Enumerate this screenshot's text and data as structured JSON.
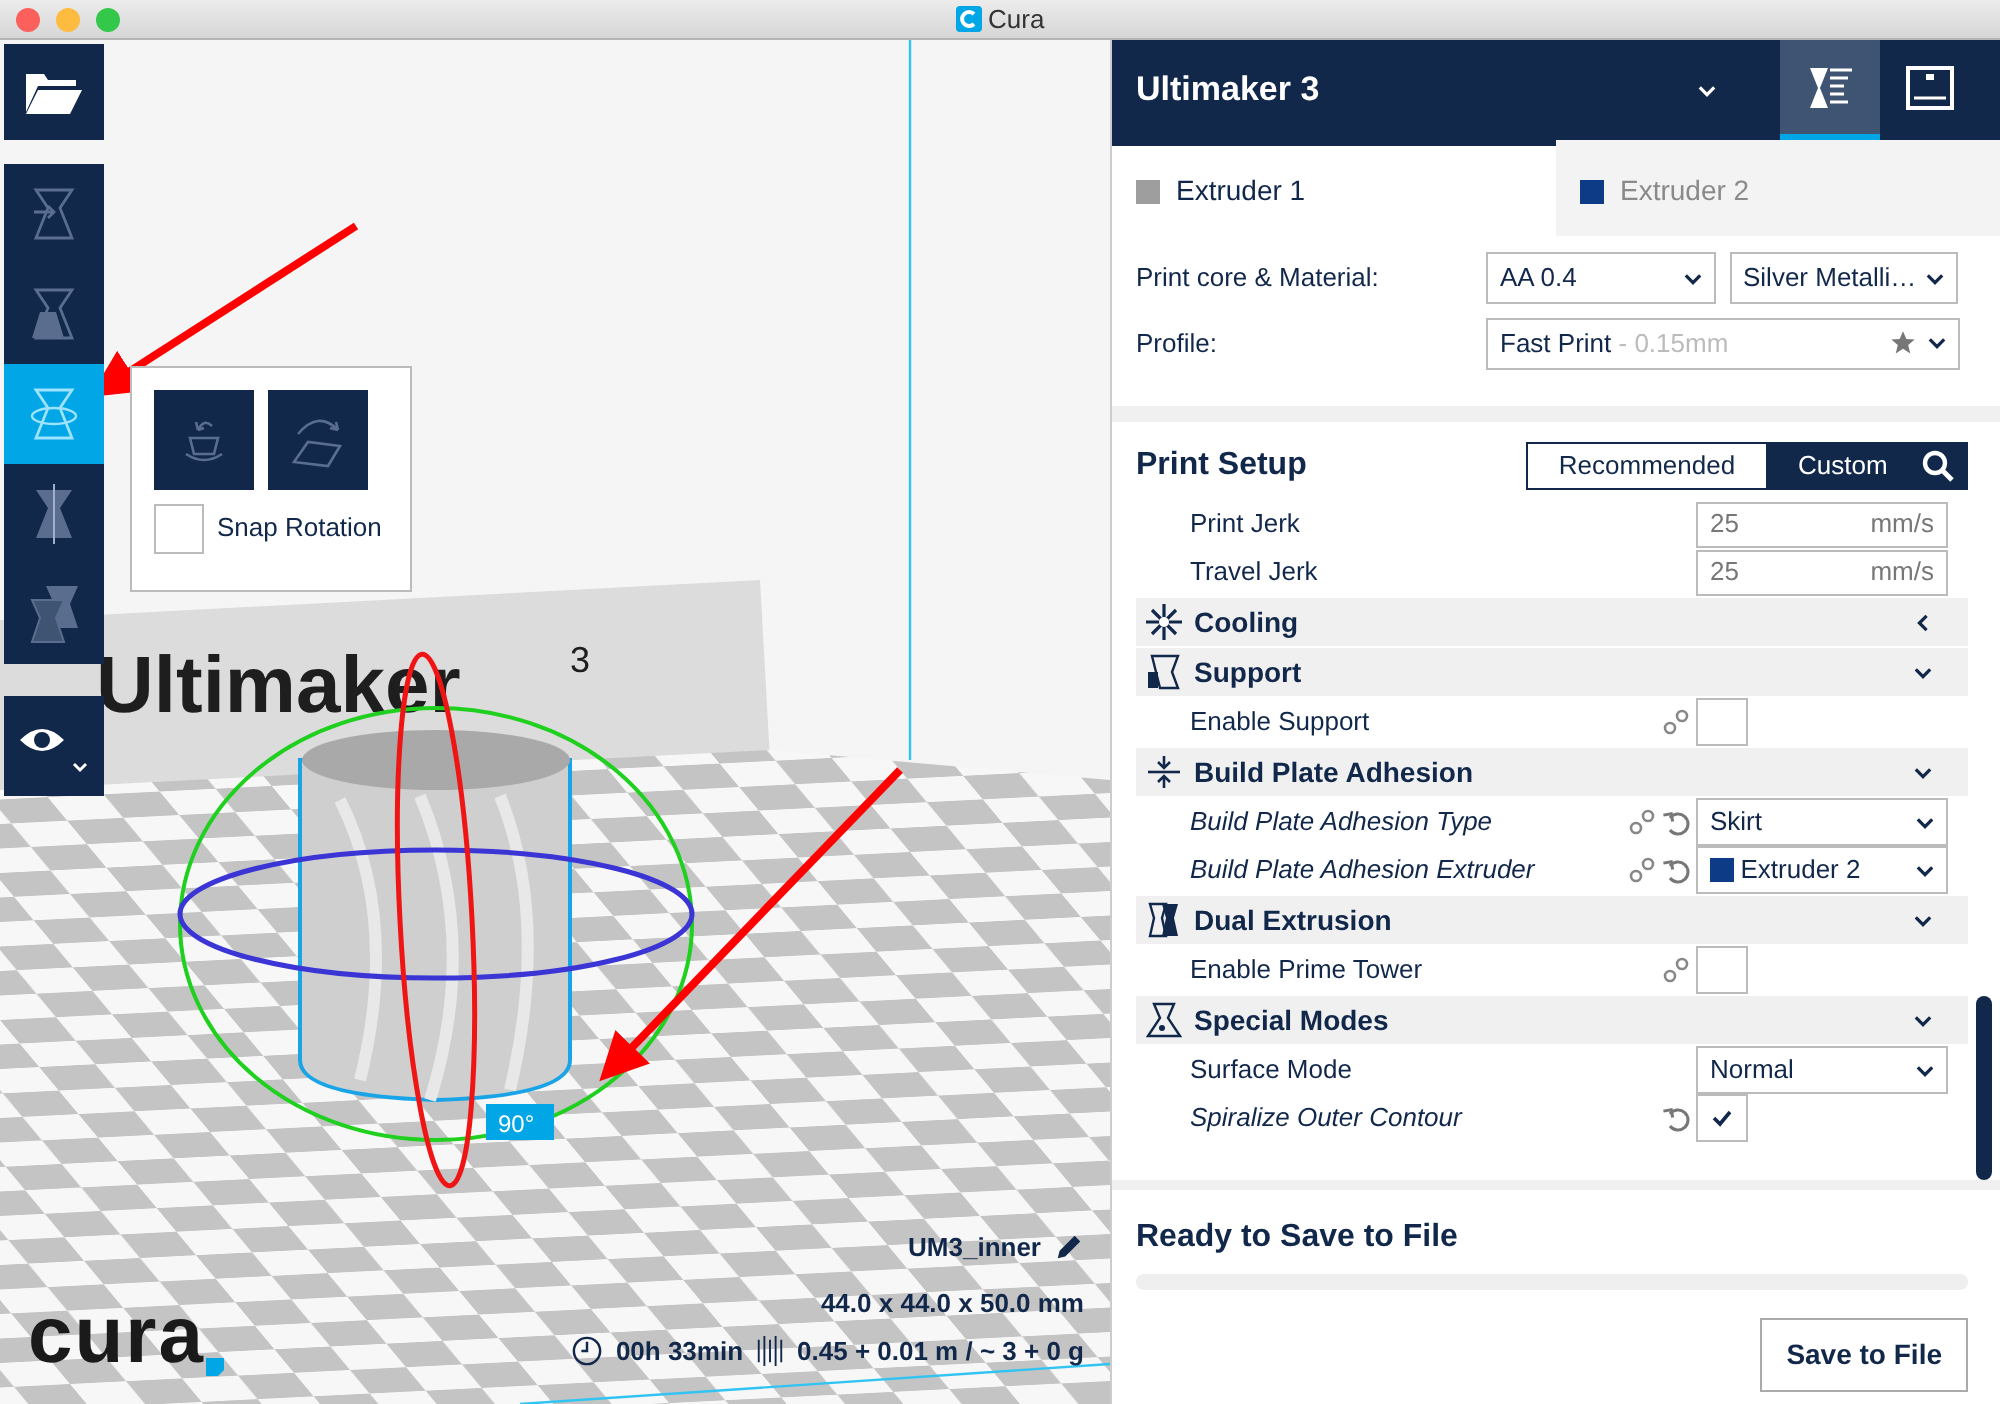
{
  "window": {
    "title": "Cura"
  },
  "tools": [
    {
      "selected": false
    },
    {
      "selected": false
    },
    {
      "selected": true
    },
    {
      "selected": false
    },
    {
      "selected": false
    }
  ],
  "rotate_panel": {
    "snap_label": "Snap Rotation",
    "snap_checked": false
  },
  "viewport": {
    "wall_logo": "Ultimaker",
    "wall_logo_superscript": "3",
    "angle_label": "90°",
    "brand": "cura",
    "job_name": "UM3_inner",
    "dimensions": "44.0 x 44.0 x 50.0 mm",
    "print_time": "00h 33min",
    "material_usage": "0.45 + 0.01 m / ~ 3 + 0 g"
  },
  "printer": {
    "name": "Ultimaker 3"
  },
  "header_tabs": [
    {
      "selected": true
    },
    {
      "selected": false
    }
  ],
  "extruders": [
    {
      "label": "Extruder 1",
      "color": "#9e9e9e",
      "selected": true
    },
    {
      "label": "Extruder 2",
      "color": "#0d3b85",
      "selected": false
    }
  ],
  "print_core": {
    "label": "Print core & Material:",
    "core": "AA 0.4",
    "material": "Silver Metalli…"
  },
  "profile": {
    "label": "Profile:",
    "name": "Fast Print",
    "detail": "- 0.15mm"
  },
  "print_setup": {
    "title": "Print Setup",
    "modes": [
      {
        "label": "Recommended",
        "selected": false
      },
      {
        "label": "Custom",
        "selected": true
      }
    ]
  },
  "settings": [
    {
      "kind": "number",
      "label": "Print Jerk",
      "value": "25",
      "unit": "mm/s"
    },
    {
      "kind": "number",
      "label": "Travel Jerk",
      "value": "25",
      "unit": "mm/s"
    },
    {
      "kind": "category",
      "label": "Cooling",
      "expanded": false
    },
    {
      "kind": "category",
      "label": "Support",
      "expanded": true
    },
    {
      "kind": "checkbox",
      "label": "Enable Support",
      "checked": false,
      "linked": true
    },
    {
      "kind": "category",
      "label": "Build Plate Adhesion",
      "expanded": true
    },
    {
      "kind": "dropdown",
      "label": "Build Plate Adhesion Type",
      "value": "Skirt",
      "overridden": true,
      "linked": true,
      "resettable": true
    },
    {
      "kind": "dropdown",
      "label": "Build Plate Adhesion Extruder",
      "value": "Extruder 2",
      "color": "#0d3b85",
      "overridden": true,
      "linked": true,
      "resettable": true
    },
    {
      "kind": "category",
      "label": "Dual Extrusion",
      "expanded": true
    },
    {
      "kind": "checkbox",
      "label": "Enable Prime Tower",
      "checked": false,
      "linked": true
    },
    {
      "kind": "category",
      "label": "Special Modes",
      "expanded": true
    },
    {
      "kind": "dropdown",
      "label": "Surface Mode",
      "value": "Normal"
    },
    {
      "kind": "checkbox",
      "label": "Spiralize Outer Contour",
      "checked": true,
      "overridden": true,
      "resettable": true
    }
  ],
  "save": {
    "status": "Ready to Save to File",
    "level": 0,
    "button": "Save to File"
  }
}
